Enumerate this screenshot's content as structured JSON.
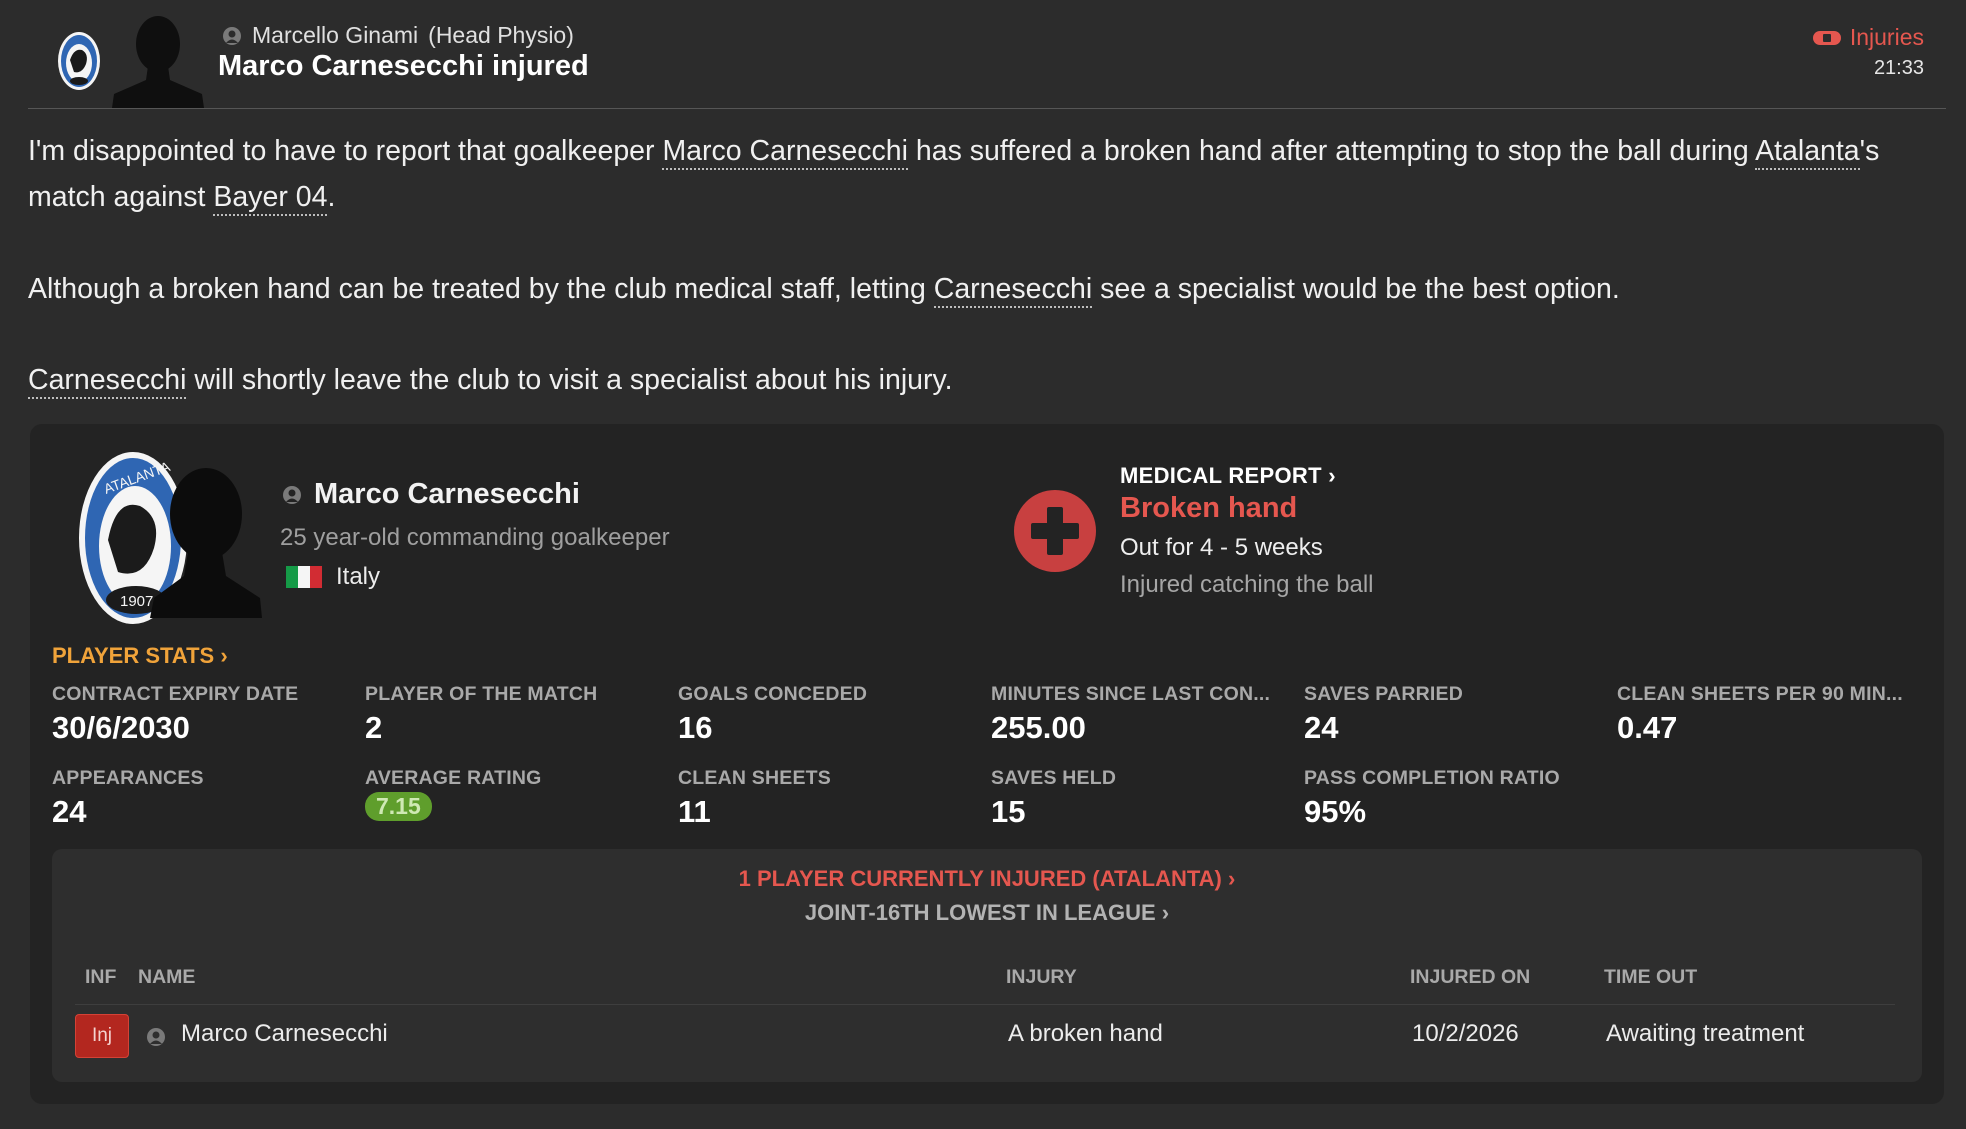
{
  "header": {
    "sender_name": "Marcello Ginami",
    "sender_role": "(Head Physio)",
    "title": "Marco Carnesecchi injured",
    "category": "Injuries",
    "time": "21:33"
  },
  "message": {
    "p1_a": "I'm disappointed to have to report that goalkeeper ",
    "p1_player": "Marco Carnesecchi",
    "p1_b": " has suffered a broken hand after attempting to stop the ball during ",
    "p1_club": "Atalanta",
    "p1_c": "'s match against ",
    "p1_opponent": "Bayer 04",
    "p1_d": ".",
    "p2_a": "Although a broken hand can be treated by the club medical staff, letting ",
    "p2_player": "Carnesecchi",
    "p2_b": " see a specialist would be the best option.",
    "p3_player": "Carnesecchi",
    "p3_a": " will shortly leave the club to visit a specialist about his injury."
  },
  "player": {
    "name": "Marco Carnesecchi",
    "description": "25 year-old commanding goalkeeper",
    "nation": "Italy",
    "crest_text_top": "ATALANTA",
    "crest_year": "1907"
  },
  "medical": {
    "header": "MEDICAL REPORT",
    "injury": "Broken hand",
    "duration": "Out for 4 - 5 weeks",
    "cause": "Injured catching the ball"
  },
  "stats": {
    "header": "PLAYER STATS",
    "row1": [
      {
        "label": "CONTRACT EXPIRY DATE",
        "value": "30/6/2030"
      },
      {
        "label": "PLAYER OF THE MATCH",
        "value": "2"
      },
      {
        "label": "GOALS CONCEDED",
        "value": "16"
      },
      {
        "label": "MINUTES SINCE LAST CON...",
        "value": "255.00"
      },
      {
        "label": "SAVES PARRIED",
        "value": "24"
      },
      {
        "label": "CLEAN SHEETS PER 90 MIN...",
        "value": "0.47"
      }
    ],
    "row2": [
      {
        "label": "APPEARANCES",
        "value": "24"
      },
      {
        "label": "AVERAGE RATING",
        "value": "7.15"
      },
      {
        "label": "CLEAN SHEETS",
        "value": "11"
      },
      {
        "label": "SAVES HELD",
        "value": "15"
      },
      {
        "label": "PASS COMPLETION RATIO",
        "value": "95%"
      }
    ]
  },
  "injury_list": {
    "summary": "1 PLAYER CURRENTLY INJURED (ATALANTA)",
    "rank": "JOINT-16TH LOWEST IN LEAGUE",
    "columns": {
      "inf": "INF",
      "name": "NAME",
      "injury": "INJURY",
      "injured_on": "INJURED ON",
      "time_out": "TIME OUT"
    },
    "rows": [
      {
        "inf": "Inj",
        "name": "Marco Carnesecchi",
        "injury": "A broken hand",
        "injured_on": "10/2/2026",
        "time_out": "Awaiting treatment"
      }
    ]
  },
  "colors": {
    "background": "#2c2c2c",
    "card": "#232323",
    "accent_red": "#e5574f",
    "accent_orange": "#f0a33a",
    "rating_green": "#5f9e2c"
  },
  "icons": {
    "club_crest": "atalanta-crest-icon",
    "person": "person-icon",
    "injuries_category": "bandage-icon",
    "medical": "medical-cross-icon",
    "chevron": "chevron-right-icon"
  }
}
